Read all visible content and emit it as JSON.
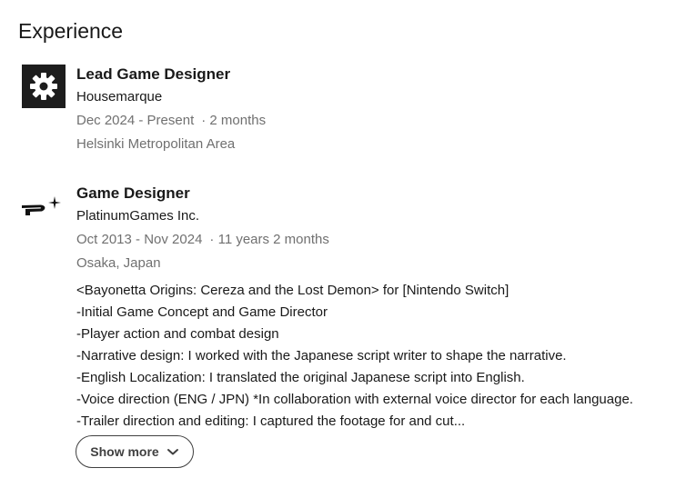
{
  "section": {
    "title": "Experience"
  },
  "experiences": [
    {
      "role": "Lead Game Designer",
      "company": "Housemarque",
      "dates": "Dec 2024 - Present",
      "duration": "· 2 months",
      "location": "Helsinki Metropolitan Area",
      "logo_icon": "housemarque-gear-logo"
    },
    {
      "role": "Game Designer",
      "company": "PlatinumGames Inc.",
      "dates": "Oct 2013 - Nov 2024",
      "duration": "· 11 years 2 months",
      "location": "Osaka, Japan",
      "logo_icon": "platinumgames-logo",
      "description": [
        "<Bayonetta Origins: Cereza and the Lost Demon> for [Nintendo Switch]",
        "-Initial Game Concept and Game Director",
        "-Player action and combat design",
        "-Narrative design: I worked with the Japanese script writer to shape the narrative.",
        "-English Localization: I translated the original Japanese script into English.",
        "-Voice direction (ENG / JPN) *In collaboration with external voice director for each language.",
        "-Trailer direction and editing: I captured the footage for and cut..."
      ],
      "show_more_label": "Show more",
      "show_more_icon": "chevron-down-icon"
    }
  ]
}
